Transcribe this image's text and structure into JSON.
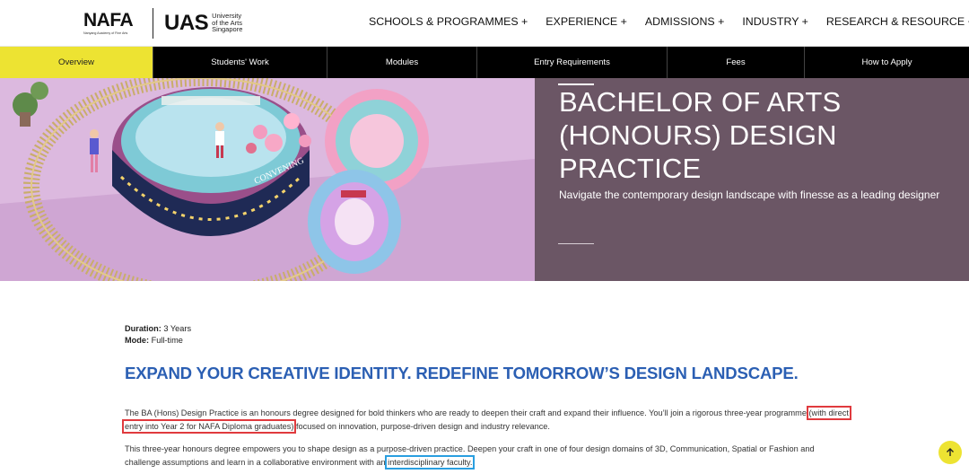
{
  "brand": {
    "nafa_word": "NAFA",
    "nafa_sub": "Nanyang Academy of Fine Arts",
    "uas_word": "UAS",
    "uas_sub_1": "University",
    "uas_sub_2": "of the Arts",
    "uas_sub_3": "Singapore"
  },
  "nav": {
    "items": [
      "SCHOOLS & PROGRAMMES +",
      "EXPERIENCE +",
      "ADMISSIONS +",
      "INDUSTRY +",
      "RESEARCH & RESOURCE +"
    ]
  },
  "tabs": {
    "items": [
      "Overview",
      "Students' Work",
      "Modules",
      "Entry Requirements",
      "Fees",
      "How to Apply"
    ],
    "active": "Overview"
  },
  "hero": {
    "title": "BACHELOR OF ARTS (HONOURS) DESIGN PRACTICE",
    "subtitle": "Navigate the contemporary design landscape with finesse as a leading designer",
    "sign_text": "CONVENING",
    "panel_color": "#6b5665",
    "image_bg": "#d9b7dd"
  },
  "content": {
    "duration_label": "Duration:",
    "duration_value": "3 Years",
    "mode_label": "Mode:",
    "mode_value": "Full-time",
    "headline": "EXPAND YOUR CREATIVE IDENTITY. REDEFINE TOMORROW’S DESIGN LANDSCAPE.",
    "p1_a": "The BA (Hons) Design Practice is an honours degree designed for bold thinkers who are ready to deepen their craft and expand their influence. You’ll join a rigorous three-year programme ",
    "p1_hl_1": "(with direct",
    "p1_hl_2": "entry into Year 2 for NAFA Diploma graduates)",
    "p1_b": " focused on innovation, purpose-driven design and industry relevance.",
    "p2_a": "This three-year honours degree empowers you to shape design as a purpose-driven practice. Deepen your craft in one of four design domains of 3D, Communication, Spatial or Fashion and challenge assumptions and learn in a collaborative environment with an ",
    "p2_hl": "interdisciplinary faculty.",
    "headline_color": "#2b5fb3",
    "accent_yellow": "#ede332"
  },
  "icons": {
    "scroll_top": "arrow-up-icon"
  }
}
